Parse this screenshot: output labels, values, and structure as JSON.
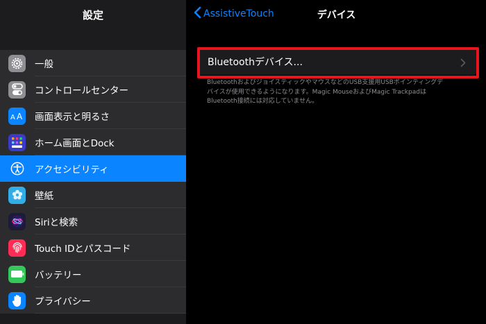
{
  "sidebar": {
    "title": "設定",
    "items": [
      {
        "label": "一般",
        "icon": "gear-icon",
        "color": "#8e8e93"
      },
      {
        "label": "コントロールセンター",
        "icon": "toggles-icon",
        "color": "#8e8e93"
      },
      {
        "label": "画面表示と明るさ",
        "icon": "text-size-icon",
        "color": "#0a84ff"
      },
      {
        "label": "ホーム画面とDock",
        "icon": "home-grid-icon",
        "color": "#3a3cc8"
      },
      {
        "label": "アクセシビリティ",
        "icon": "accessibility-icon",
        "color": "#0a84ff",
        "selected": true
      },
      {
        "label": "壁紙",
        "icon": "flower-icon",
        "color": "#32ade6"
      },
      {
        "label": "Siriと検索",
        "icon": "siri-icon",
        "color": "#222"
      },
      {
        "label": "Touch IDとパスコード",
        "icon": "fingerprint-icon",
        "color": "#ff2d55"
      },
      {
        "label": "バッテリー",
        "icon": "battery-icon",
        "color": "#34c759"
      },
      {
        "label": "プライバシー",
        "icon": "hand-icon",
        "color": "#0a84ff"
      }
    ]
  },
  "nav": {
    "back_label": "AssistiveTouch",
    "title": "デバイス"
  },
  "main": {
    "bluetooth_cell_label": "Bluetoothデバイス...",
    "footnote": "BluetoothおよびジョイスティックやマウスなどのUSB支援用USBポインティングデ\nバイスが使用できるようになります。Magic MouseおよびMagic Trackpadは\nBluetooth接続には対応していません。"
  },
  "colors": {
    "accent": "#0a84ff",
    "highlight": "#e8141e"
  }
}
